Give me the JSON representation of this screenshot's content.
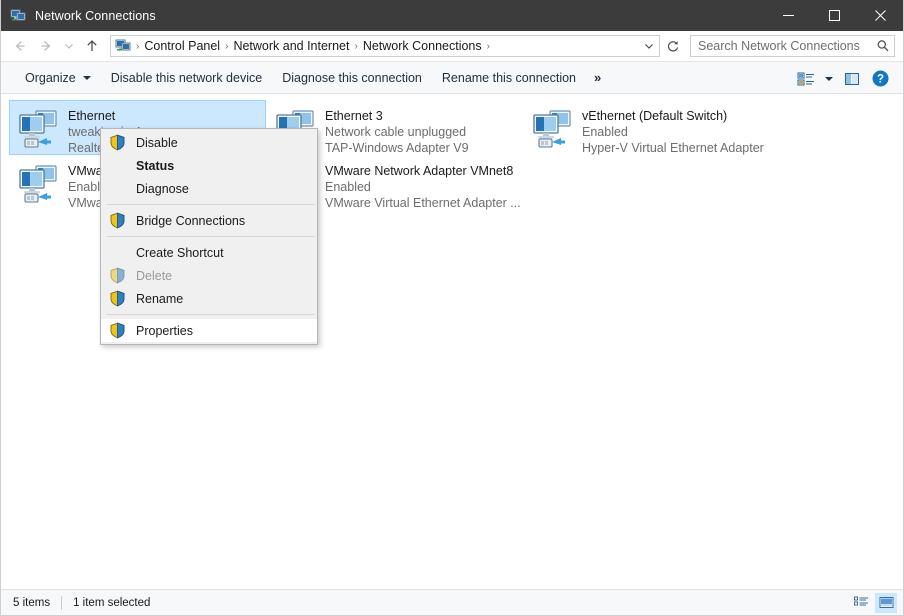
{
  "window": {
    "title": "Network Connections",
    "icon": "network-connections-icon",
    "controls": {
      "minimize": "minimize-icon",
      "maximize": "maximize-icon",
      "close": "close-icon"
    }
  },
  "address_bar": {
    "back": "back-arrow-icon",
    "forward": "forward-arrow-icon",
    "recent": "chevron-down-icon",
    "up": "up-arrow-icon",
    "breadcrumb_icon": "control-panel-icon",
    "breadcrumbs": [
      "Control Panel",
      "Network and Internet",
      "Network Connections"
    ],
    "separator": "›",
    "dropdown": "chevron-down-icon",
    "refresh": "refresh-icon"
  },
  "search": {
    "placeholder": "Search Network Connections",
    "value": "",
    "icon": "search-icon"
  },
  "toolbar": {
    "organize_label": "Organize",
    "disable_label": "Disable this network device",
    "diagnose_label": "Diagnose this connection",
    "rename_label": "Rename this connection",
    "overflow_label": "»",
    "view_options_icon": "view-options-icon",
    "preview_pane_icon": "preview-pane-icon",
    "help_icon": "help-icon"
  },
  "connections": [
    {
      "name": "Ethernet",
      "status": "tweaking.in 4",
      "adapter": "Realtek PCIe GbE Family Controller",
      "selected": true,
      "icon": "network-adapter-connected-icon"
    },
    {
      "name": "Ethernet 3",
      "status": "Network cable unplugged",
      "adapter": "TAP-Windows Adapter V9",
      "selected": false,
      "icon": "network-adapter-unplugged-icon"
    },
    {
      "name": "vEthernet (Default Switch)",
      "status": "Enabled",
      "adapter": "Hyper-V Virtual Ethernet Adapter",
      "selected": false,
      "icon": "network-adapter-connected-icon"
    },
    {
      "name": "VMware Network Adapter VMnet1",
      "status": "Enabled",
      "adapter": "VMware Virtual Ethernet Adapter ...",
      "selected": false,
      "icon": "network-adapter-connected-icon"
    },
    {
      "name": "VMware Network Adapter VMnet8",
      "status": "Enabled",
      "adapter": "VMware Virtual Ethernet Adapter ...",
      "selected": false,
      "icon": "network-adapter-connected-icon"
    }
  ],
  "context_menu": {
    "items": [
      {
        "label": "Disable",
        "shield": true,
        "bold": false,
        "disabled": false,
        "separator_after": false,
        "highlight": false
      },
      {
        "label": "Status",
        "shield": false,
        "bold": true,
        "disabled": false,
        "separator_after": false,
        "highlight": false
      },
      {
        "label": "Diagnose",
        "shield": false,
        "bold": false,
        "disabled": false,
        "separator_after": true,
        "highlight": false
      },
      {
        "label": "Bridge Connections",
        "shield": true,
        "bold": false,
        "disabled": false,
        "separator_after": true,
        "highlight": false
      },
      {
        "label": "Create Shortcut",
        "shield": false,
        "bold": false,
        "disabled": false,
        "separator_after": false,
        "highlight": false
      },
      {
        "label": "Delete",
        "shield": true,
        "bold": false,
        "disabled": true,
        "separator_after": false,
        "highlight": false
      },
      {
        "label": "Rename",
        "shield": true,
        "bold": false,
        "disabled": false,
        "separator_after": true,
        "highlight": false
      },
      {
        "label": "Properties",
        "shield": true,
        "bold": false,
        "disabled": false,
        "separator_after": false,
        "highlight": true
      }
    ]
  },
  "status_bar": {
    "item_count": "5 items",
    "selection": "1 item selected",
    "details_view_icon": "details-view-icon",
    "large_icons_view_icon": "large-icons-view-icon"
  },
  "colors": {
    "titlebar": "#3c3c3c",
    "selection": "#cce8ff",
    "selection_border": "#99d1ff",
    "accent": "#0078d7",
    "menu_bg": "#f0f0f0",
    "toolbar_bg": "#f7f8f9"
  }
}
